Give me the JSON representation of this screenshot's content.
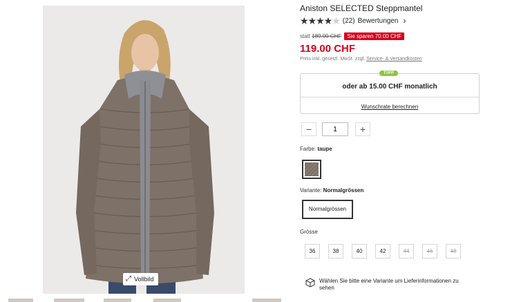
{
  "product": {
    "title": "Aniston SELECTED Steppmantel",
    "rating_count": "(22)",
    "reviews_label": "Bewertungen",
    "stars_filled": 4,
    "stars_total": 5
  },
  "pricing": {
    "statt_label": "statt",
    "old_price": "189.00 CHF",
    "save_badge": "Sie sparen 70.00 CHF",
    "price": "119.00 CHF",
    "vat_text": "Preis inkl. gesetzl. MwSt. zzgl.",
    "shipping_link": "Service- & Versandkosten"
  },
  "financing": {
    "badge": "TIPP",
    "text": "oder ab 15.00 CHF monatlich",
    "link": "Wunschrate berechnen"
  },
  "quantity": {
    "minus": "−",
    "value": "1",
    "plus": "+"
  },
  "color": {
    "label": "Farbe:",
    "value": "taupe"
  },
  "variant": {
    "label": "Variante:",
    "value": "Normalgrössen",
    "option": "Normalgrössen"
  },
  "size": {
    "label": "Grösse",
    "options": [
      {
        "label": "36",
        "available": true
      },
      {
        "label": "38",
        "available": true
      },
      {
        "label": "40",
        "available": true
      },
      {
        "label": "42",
        "available": true
      },
      {
        "label": "44",
        "available": false
      },
      {
        "label": "46",
        "available": false
      },
      {
        "label": "48",
        "available": false
      }
    ]
  },
  "delivery": {
    "icon": "package-icon",
    "text": "Wählen Sie bitte eine Variante um Lieferinformationen zu sehen"
  },
  "gallery": {
    "fullscreen_label": "Vollbild",
    "fullscreen_icon": "expand-icon"
  }
}
